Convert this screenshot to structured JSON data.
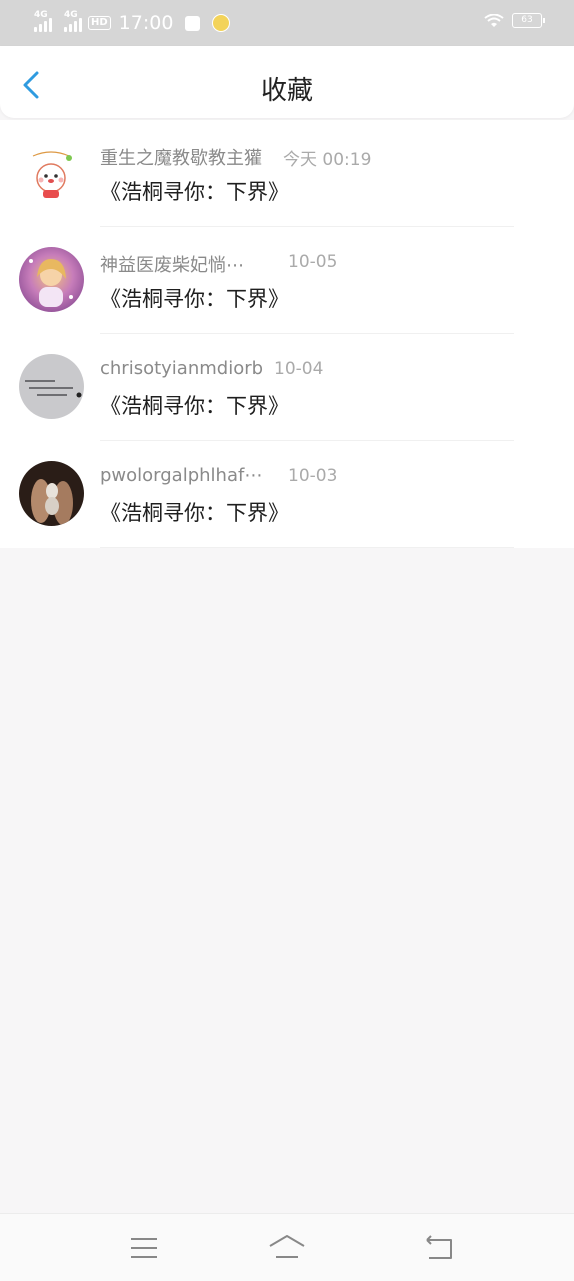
{
  "status_bar": {
    "network1": "4G",
    "network2": "4G",
    "hd": "HD",
    "time": "17:00",
    "battery": "63"
  },
  "header": {
    "title": "收藏"
  },
  "items": [
    {
      "name": "重生之魔教歇教主獾",
      "date": "今天 00:19",
      "content": "《浩桐寻你：下界》",
      "avatar_icon": "cartoon-avatar-icon"
    },
    {
      "name": "神益医废柴妃惝⋯",
      "date": "10-05",
      "content": "《浩桐寻你：下界》",
      "avatar_icon": "illustration-avatar-icon"
    },
    {
      "name": "chrisotyianmdiorb",
      "date": "10-04",
      "content": "《浩桐寻你：下界》",
      "avatar_icon": "text-avatar-icon"
    },
    {
      "name": "pwolorgalphlhaf⋯",
      "date": "10-03",
      "content": "《浩桐寻你：下界》",
      "avatar_icon": "photo-avatar-icon"
    }
  ],
  "nav": {
    "menu_icon": "menu-icon",
    "home_icon": "home-icon",
    "back_icon": "back-icon"
  },
  "colors": {
    "accent": "#2f9be0",
    "page_bg": "#f7f6f7"
  }
}
